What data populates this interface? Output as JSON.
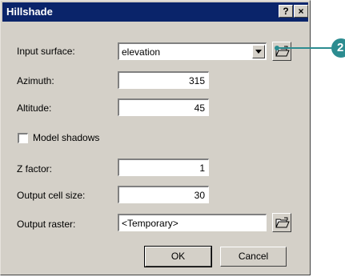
{
  "window": {
    "title": "Hillshade",
    "help_label": "?",
    "close_label": "×"
  },
  "fields": {
    "input_surface": {
      "label": "Input surface:",
      "value": "elevation",
      "icon": "folder-open-icon"
    },
    "azimuth": {
      "label": "Azimuth:",
      "value": "315"
    },
    "altitude": {
      "label": "Altitude:",
      "value": "45"
    },
    "model_shadows": {
      "label": "Model shadows",
      "checked": false
    },
    "z_factor": {
      "label": "Z factor:",
      "value": "1"
    },
    "output_cell_size": {
      "label": "Output cell size:",
      "value": "30"
    },
    "output_raster": {
      "label": "Output raster:",
      "value": "<Temporary>",
      "icon": "folder-open-icon"
    }
  },
  "buttons": {
    "ok_label": "OK",
    "cancel_label": "Cancel"
  },
  "callout": {
    "number": "2",
    "color": "#2c8c90"
  },
  "colors": {
    "title_bar": "#0a246a",
    "dialog_bg": "#d4d0c8"
  }
}
